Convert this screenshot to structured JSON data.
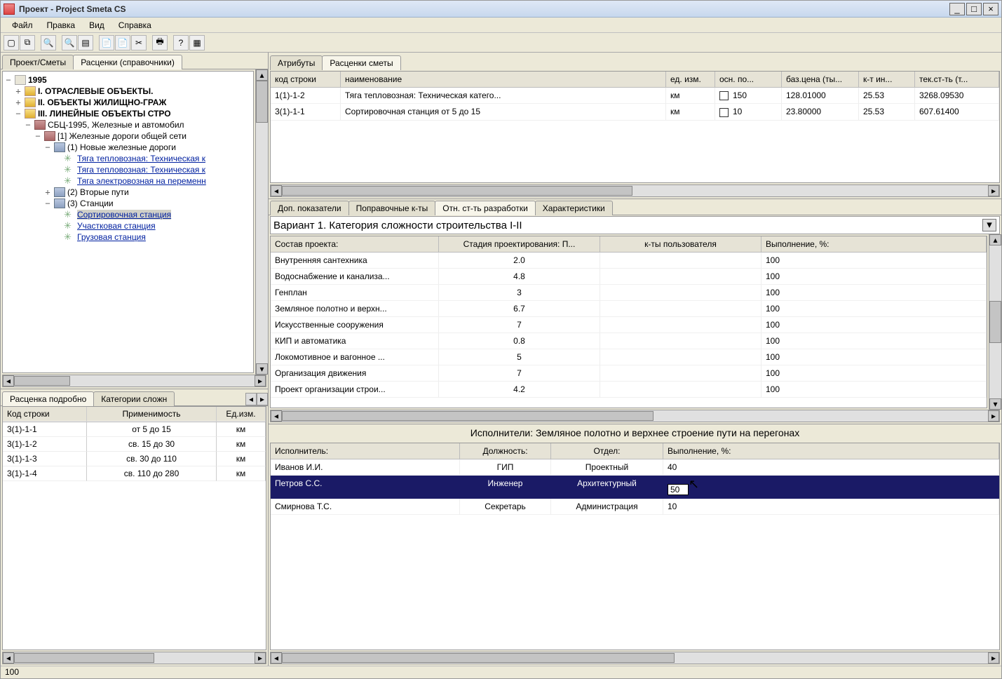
{
  "title": "Проект - Project Smeta CS",
  "menu": {
    "file": "Файл",
    "edit": "Правка",
    "view": "Вид",
    "help": "Справка"
  },
  "leftTabs": {
    "project": "Проект/Сметы",
    "rates": "Расценки (справочники)"
  },
  "tree": {
    "root": "1995",
    "n1": "I.   ОТРАСЛЕВЫЕ ОБЪЕКТЫ.",
    "n2": "II.  ОБЪЕКТЫ ЖИЛИЩНО-ГРАЖ",
    "n3": "III. ЛИНЕЙНЫЕ ОБЪЕКТЫ СТРО",
    "sbc": "СБЦ-1995, Железные и автомобил",
    "ch1": "[1] Железные дороги общей сети",
    "g1": "(1) Новые железные дороги",
    "it1": "Тяга тепловозная: Техническая к",
    "it2": "Тяга тепловозная: Техническая к",
    "it3": "Тяга электровозная на переменн",
    "g2": "(2) Вторые пути",
    "g3": "(3) Станции",
    "s1": "Сортировочная станция",
    "s2": "Участковая станция",
    "s3": "Грузовая станция"
  },
  "blTabs": {
    "detail": "Расценка подробно",
    "categories": "Категории сложн"
  },
  "miniTable": {
    "h1": "Код строки",
    "h2": "Применимость",
    "h3": "Ед.изм.",
    "rows": [
      {
        "c": "3(1)-1-1",
        "a": "от 5 до 15",
        "u": "км"
      },
      {
        "c": "3(1)-1-2",
        "a": "св. 15 до 30",
        "u": "км"
      },
      {
        "c": "3(1)-1-3",
        "a": "св. 30 до 110",
        "u": "км"
      },
      {
        "c": "3(1)-1-4",
        "a": "св. 110 до 280",
        "u": "км"
      }
    ]
  },
  "rightTopTabs": {
    "attr": "Атрибуты",
    "rates": "Расценки сметы"
  },
  "topGrid": {
    "h1": "код строки",
    "h2": "наименование",
    "h3": "ед. изм.",
    "h4": "осн. по...",
    "h5": "баз.цена (ты...",
    "h6": "к-т ин...",
    "h7": "тек.ст-ть (т...",
    "rows": [
      {
        "c": "1(1)-1-2",
        "n": "Тяга тепловозная: Техническая катего...",
        "u": "км",
        "o": "150",
        "b": "128.01000",
        "k": "25.53",
        "t": "3268.09530"
      },
      {
        "c": "3(1)-1-1",
        "n": "Сортировочная станция от 5 до 15",
        "u": "км",
        "o": "10",
        "b": "23.80000",
        "k": "25.53",
        "t": "607.61400"
      }
    ]
  },
  "innerTabs": {
    "dop": "Доп. показатели",
    "pop": "Поправочные к-ты",
    "otn": "Отн. ст-ть разработки",
    "har": "Характеристики"
  },
  "variant": "Вариант 1. Категория сложности строительства I-II",
  "detailHdr": {
    "h1": "Состав проекта:",
    "h2": "Стадия проектирования: П...",
    "h3": "к-ты пользователя",
    "h4": "Выполнение, %:"
  },
  "detailRows": [
    {
      "n": "Внутренняя сантехника",
      "v": "2.0",
      "p": "100"
    },
    {
      "n": "Водоснабжение и канализа...",
      "v": "4.8",
      "p": "100"
    },
    {
      "n": "Генплан",
      "v": "3",
      "p": "100"
    },
    {
      "n": "Земляное полотно и верхн...",
      "v": "6.7",
      "p": "100"
    },
    {
      "n": "Искусственные сооружения",
      "v": "7",
      "p": "100"
    },
    {
      "n": "КИП и автоматика",
      "v": "0.8",
      "p": "100"
    },
    {
      "n": "Локомотивное и вагонное ...",
      "v": "5",
      "p": "100"
    },
    {
      "n": "Организация движения",
      "v": "7",
      "p": "100"
    },
    {
      "n": "Проект организации строи...",
      "v": "4.2",
      "p": "100"
    }
  ],
  "perfTitle": "Исполнители: Земляное полотно и верхнее строение пути на перегонах",
  "perfHdr": {
    "h1": "Исполнитель:",
    "h2": "Должность:",
    "h3": "Отдел:",
    "h4": "Выполнение, %:"
  },
  "perfRows": [
    {
      "n": "Иванов И.И.",
      "d": "ГИП",
      "o": "Проектный",
      "p": "40"
    },
    {
      "n": "Петров С.С.",
      "d": "Инженер",
      "o": "Архитектурный",
      "p": "50"
    },
    {
      "n": "Смирнова Т.С.",
      "d": "Секретарь",
      "o": "Администрация",
      "p": "10"
    }
  ],
  "status": "100"
}
